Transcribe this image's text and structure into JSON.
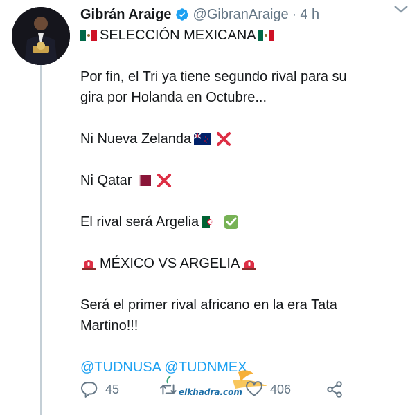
{
  "tweet": {
    "author_name": "Gibrán Araige",
    "handle": "@GibranAraige",
    "separator": "·",
    "time": "4 h",
    "lines": {
      "l1": "SELECCIÓN MEXICANA",
      "l2": "Por fin, el Tri ya tiene segundo rival para su",
      "l3": "gira por Holanda en Octubre...",
      "l4": "Ni Nueva Zelanda",
      "l5": "Ni Qatar",
      "l6": "El rival será Argelia",
      "l7": "MÉXICO VS ARGELIA",
      "l8": "Será el primer rival africano en la era Tata",
      "l9": "Martino!!!",
      "mentions": "@TUDNUSA @TUDNMEX"
    }
  },
  "actions": {
    "reply_count": "45",
    "retweet_count": "",
    "like_count": "406"
  },
  "watermark": {
    "text": "elkhadra.com"
  },
  "colors": {
    "link": "#1da1f2",
    "secondary": "#657786",
    "verified": "#1da1f2",
    "thread_line": "#c4cfd6"
  },
  "icons": [
    "verified-badge-icon",
    "chevron-down-icon",
    "mexico-flag-icon",
    "new-zealand-flag-icon",
    "qatar-flag-icon",
    "algeria-flag-icon",
    "cross-mark-icon",
    "check-mark-icon",
    "siren-icon",
    "reply-icon",
    "retweet-icon",
    "like-icon",
    "share-icon"
  ]
}
